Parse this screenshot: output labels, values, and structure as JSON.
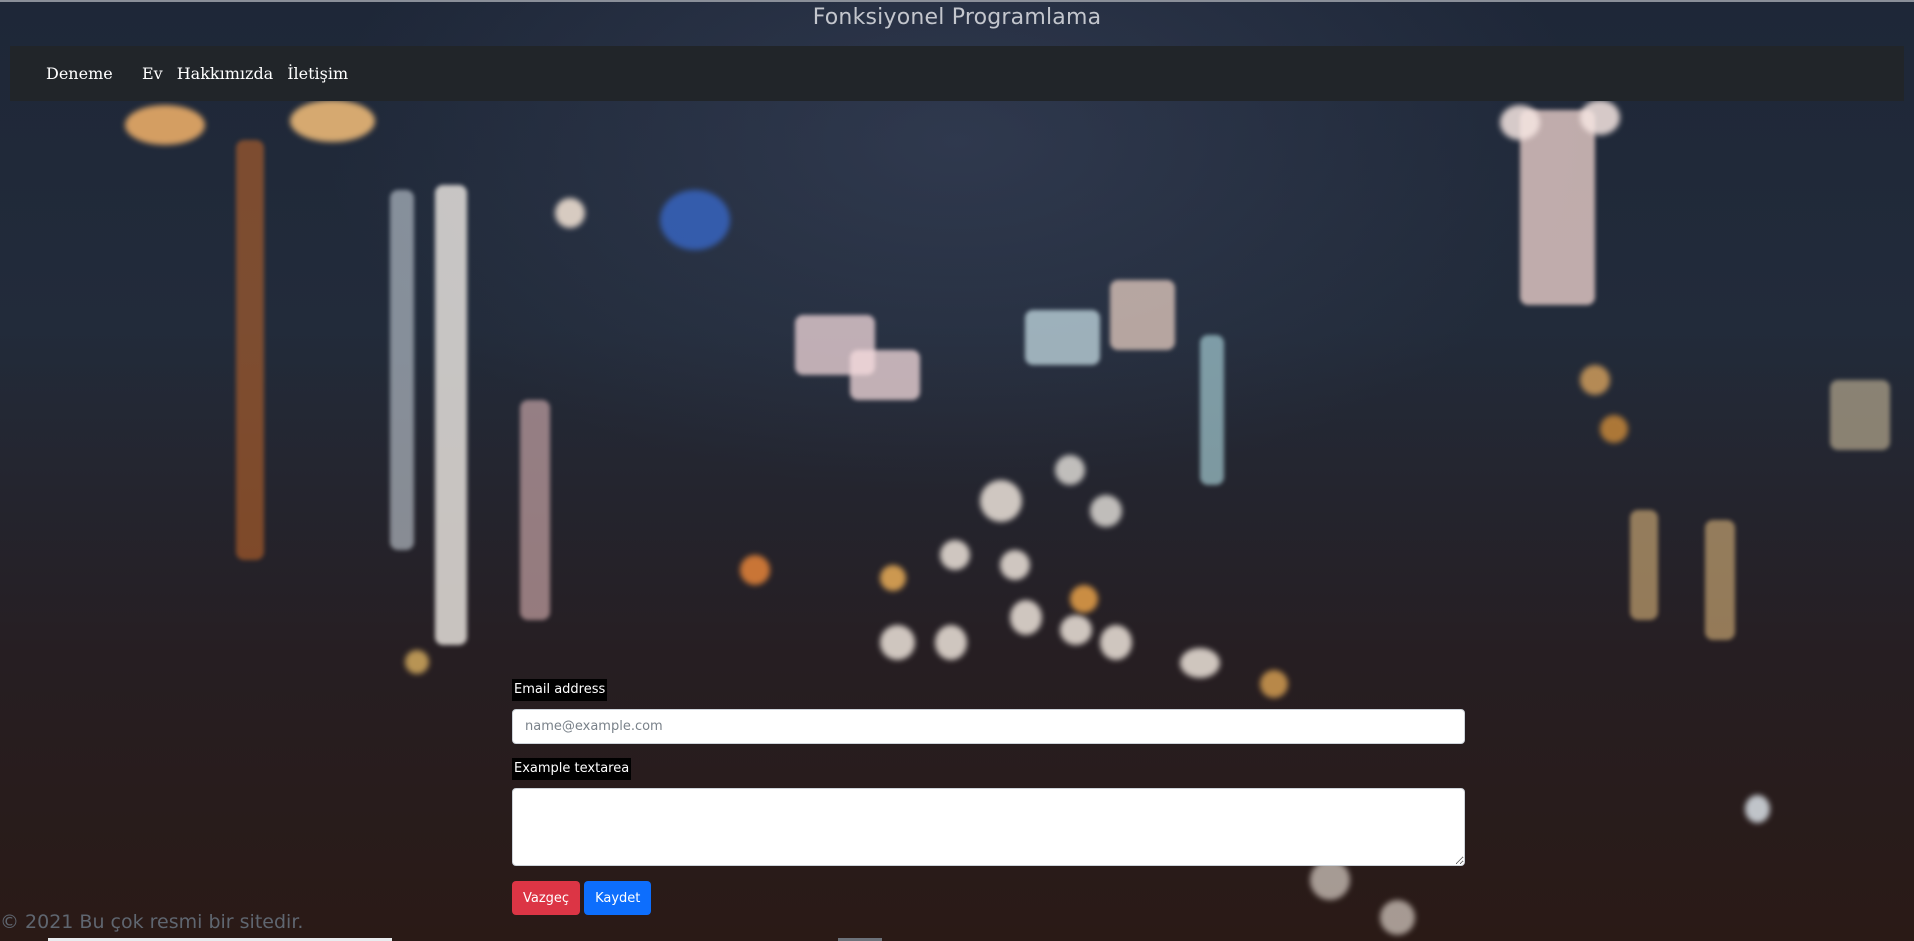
{
  "header": {
    "title": "Fonksiyonel Programlama"
  },
  "navbar": {
    "brand": "Deneme",
    "links": [
      "Ev",
      "Hakkımızda",
      "İletişim"
    ]
  },
  "form": {
    "email_label": "Email address",
    "email_placeholder": "name@example.com",
    "email_value": "",
    "textarea_label": "Example textarea",
    "textarea_value": "",
    "cancel_label": "Vazgeç",
    "save_label": "Kaydet"
  },
  "footer": {
    "text": "© 2021 Bu çok resmi bir sitedir."
  },
  "colors": {
    "navbar_bg": "#212529",
    "cancel_button": "#dc3545",
    "save_button": "#0d6efd"
  }
}
